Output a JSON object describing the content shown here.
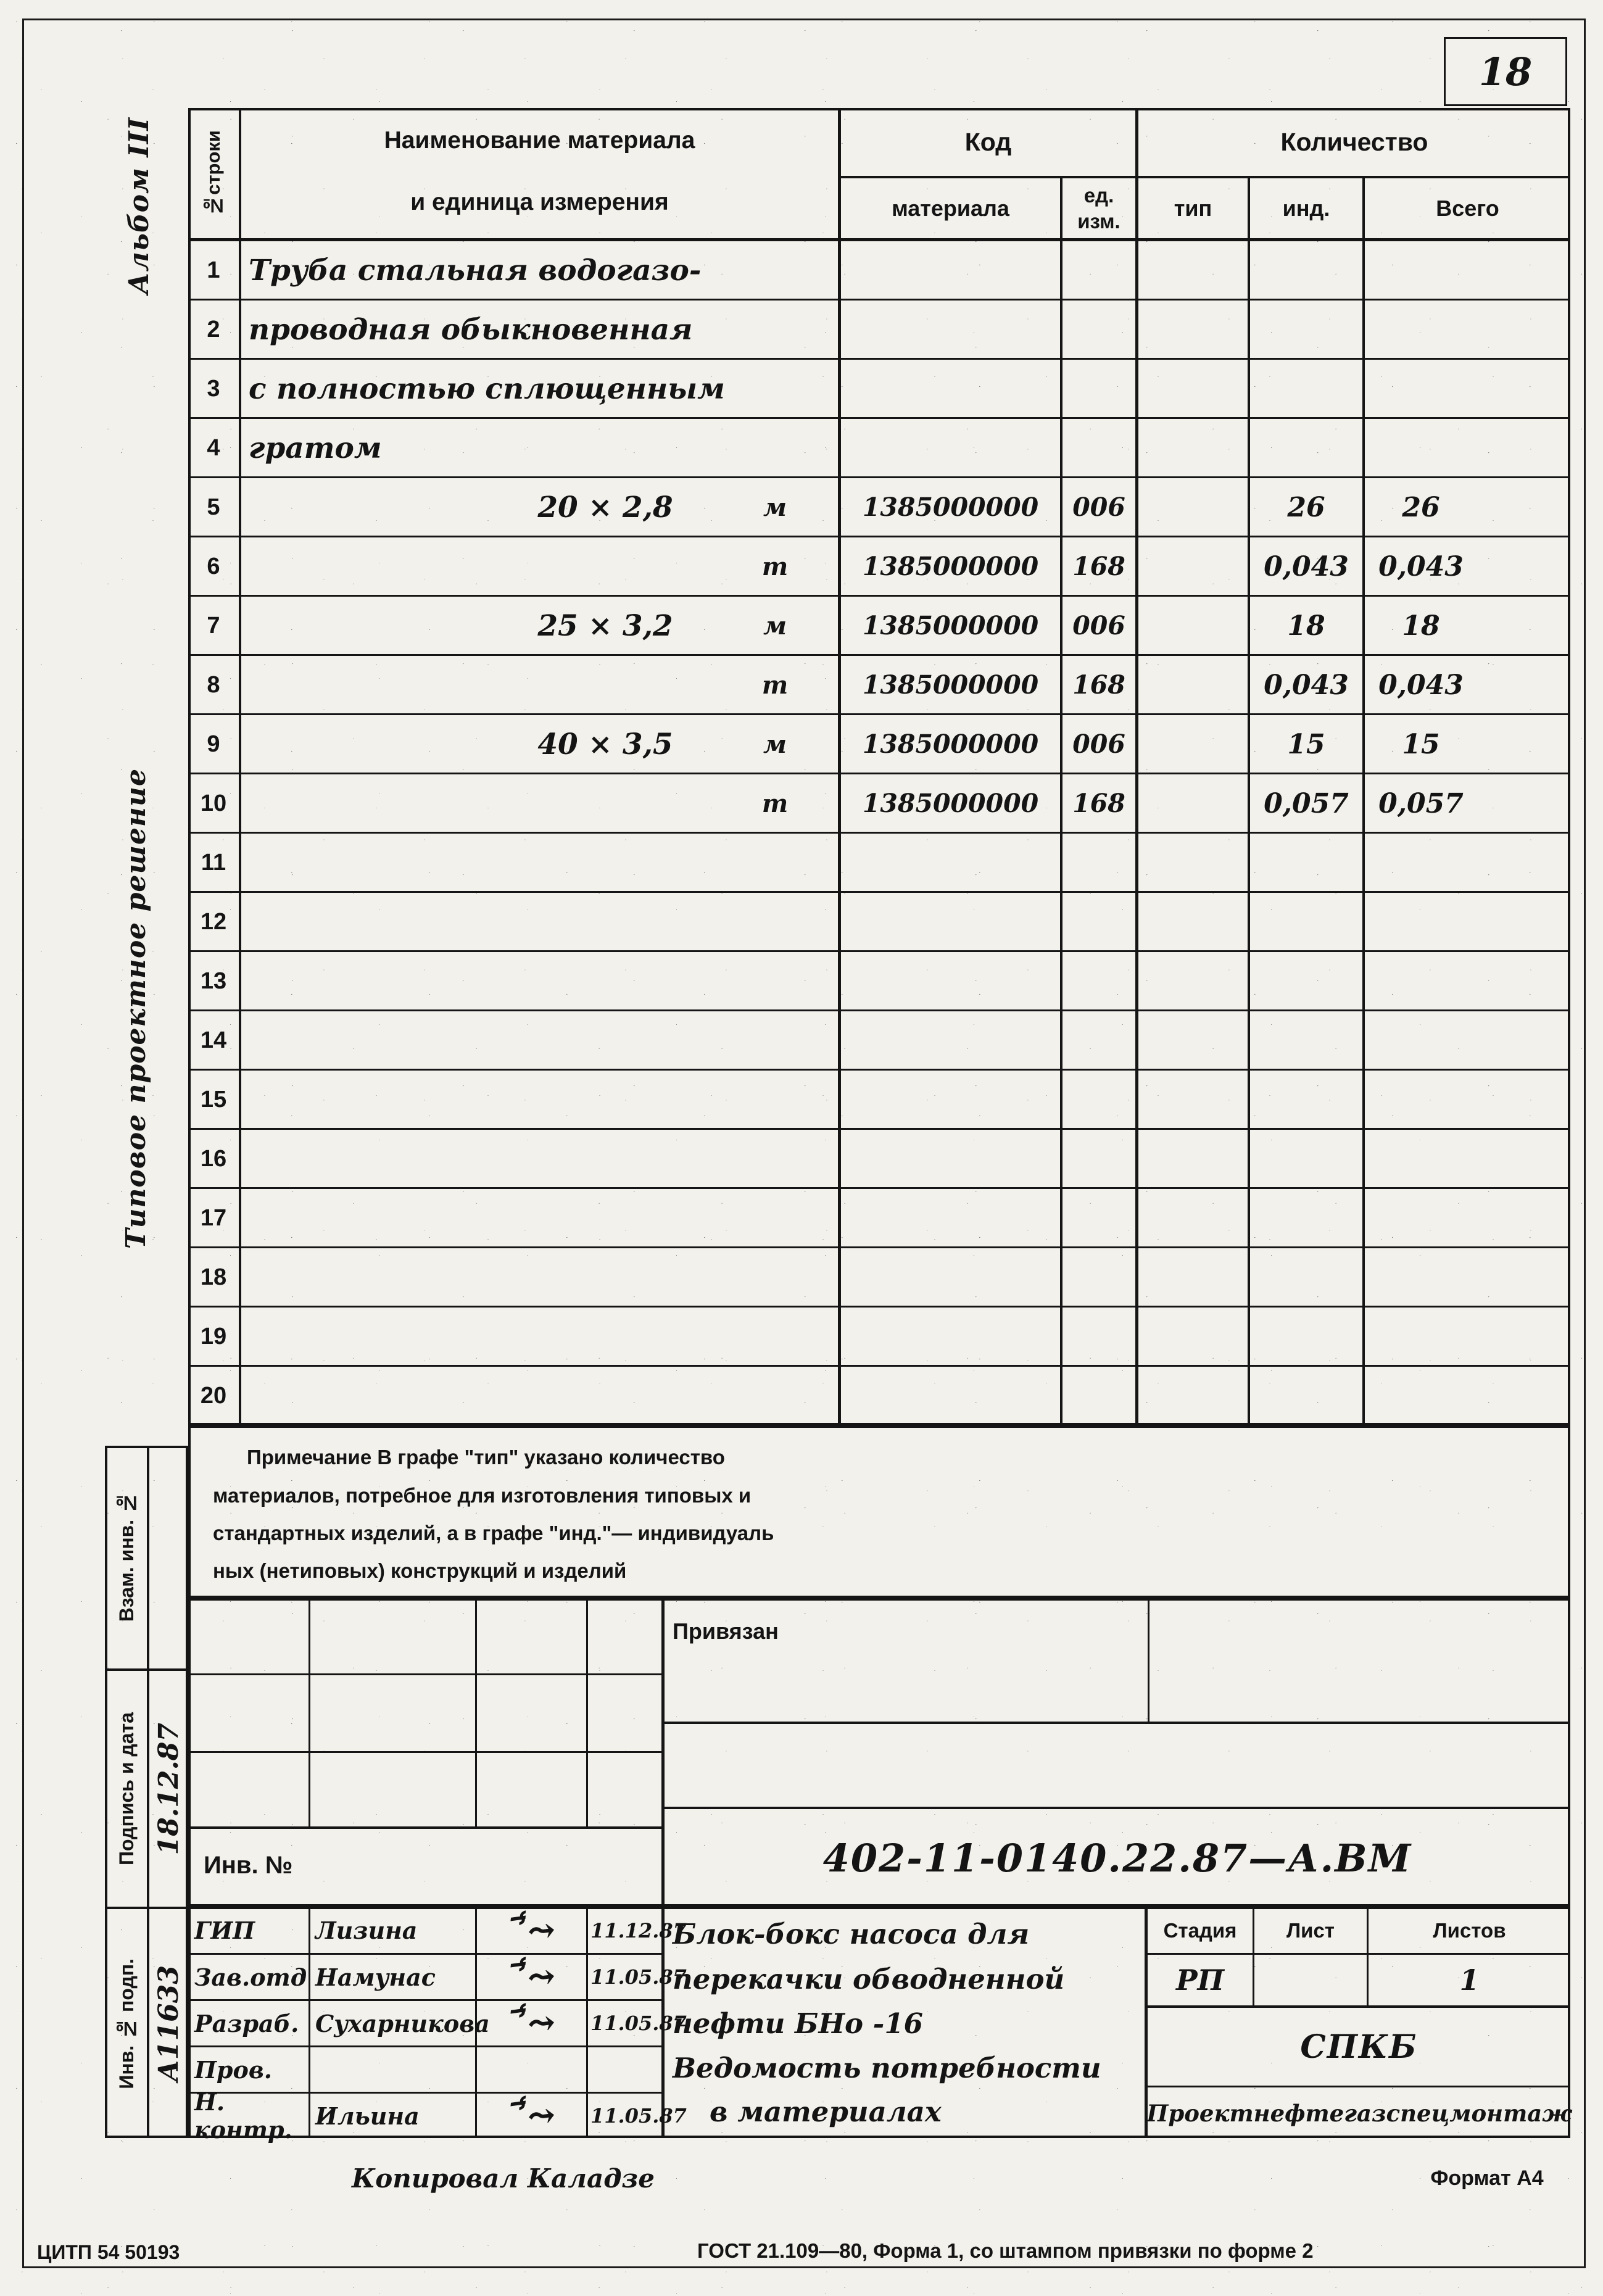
{
  "page": {
    "number": "18",
    "format_label": "Формат А4",
    "gost_footer": "ГОСТ 21.109—80, Форма 1, со штампом привязки по форме 2",
    "publisher_code": "ЦИТП    54 50193",
    "copied_by": "Копировал Каладзе"
  },
  "left_margin": {
    "album": "Альбом III",
    "typical_solution": "Типовое проектное решение",
    "stamp_labels": [
      "Взам. инв. №",
      "Подпись и дата",
      "Инв. № подп."
    ],
    "stamp_values": {
      "signature_date": "18.12.87",
      "inv_number": "А11633"
    }
  },
  "table": {
    "headers": {
      "row_no": "№строки",
      "material_name_line1": "Наименование материала",
      "material_name_line2": "и единица измерения",
      "code": "Код",
      "code_material": "материала",
      "code_unit_line1": "ед.",
      "code_unit_line2": "изм.",
      "quantity": "Количество",
      "qty_type": "тип",
      "qty_ind": "инд.",
      "qty_total": "Всего"
    },
    "rows": [
      {
        "no": "1",
        "name": "Труба стальная водогазо-",
        "code_material": "",
        "code_unit": "",
        "type": "",
        "ind": "",
        "total": ""
      },
      {
        "no": "2",
        "name": "проводная обыкновенная",
        "code_material": "",
        "code_unit": "",
        "type": "",
        "ind": "",
        "total": ""
      },
      {
        "no": "3",
        "name": "с полностью сплющенным",
        "code_material": "",
        "code_unit": "",
        "type": "",
        "ind": "",
        "total": ""
      },
      {
        "no": "4",
        "name": "гратом",
        "code_material": "",
        "code_unit": "",
        "type": "",
        "ind": "",
        "total": ""
      },
      {
        "no": "5",
        "name": "20 × 2,8",
        "unit": "м",
        "code_material": "1385000000",
        "code_unit": "006",
        "type": "",
        "ind": "26",
        "total": "26"
      },
      {
        "no": "6",
        "name": "",
        "unit": "т",
        "code_material": "1385000000",
        "code_unit": "168",
        "type": "",
        "ind": "0,043",
        "total": "0,043"
      },
      {
        "no": "7",
        "name": "25 × 3,2",
        "unit": "м",
        "code_material": "1385000000",
        "code_unit": "006",
        "type": "",
        "ind": "18",
        "total": "18"
      },
      {
        "no": "8",
        "name": "",
        "unit": "т",
        "code_material": "1385000000",
        "code_unit": "168",
        "type": "",
        "ind": "0,043",
        "total": "0,043"
      },
      {
        "no": "9",
        "name": "40 × 3,5",
        "unit": "м",
        "code_material": "1385000000",
        "code_unit": "006",
        "type": "",
        "ind": "15",
        "total": "15"
      },
      {
        "no": "10",
        "name": "",
        "unit": "т",
        "code_material": "1385000000",
        "code_unit": "168",
        "type": "",
        "ind": "0,057",
        "total": "0,057"
      },
      {
        "no": "11",
        "name": "",
        "unit": "",
        "code_material": "",
        "code_unit": "",
        "type": "",
        "ind": "",
        "total": ""
      },
      {
        "no": "12",
        "name": "",
        "unit": "",
        "code_material": "",
        "code_unit": "",
        "type": "",
        "ind": "",
        "total": ""
      },
      {
        "no": "13",
        "name": "",
        "unit": "",
        "code_material": "",
        "code_unit": "",
        "type": "",
        "ind": "",
        "total": ""
      },
      {
        "no": "14",
        "name": "",
        "unit": "",
        "code_material": "",
        "code_unit": "",
        "type": "",
        "ind": "",
        "total": ""
      },
      {
        "no": "15",
        "name": "",
        "unit": "",
        "code_material": "",
        "code_unit": "",
        "type": "",
        "ind": "",
        "total": ""
      },
      {
        "no": "16",
        "name": "",
        "unit": "",
        "code_material": "",
        "code_unit": "",
        "type": "",
        "ind": "",
        "total": ""
      },
      {
        "no": "17",
        "name": "",
        "unit": "",
        "code_material": "",
        "code_unit": "",
        "type": "",
        "ind": "",
        "total": ""
      },
      {
        "no": "18",
        "name": "",
        "unit": "",
        "code_material": "",
        "code_unit": "",
        "type": "",
        "ind": "",
        "total": ""
      },
      {
        "no": "19",
        "name": "",
        "unit": "",
        "code_material": "",
        "code_unit": "",
        "type": "",
        "ind": "",
        "total": ""
      },
      {
        "no": "20",
        "name": "",
        "unit": "",
        "code_material": "",
        "code_unit": "",
        "type": "",
        "ind": "",
        "total": ""
      }
    ]
  },
  "note": {
    "line1": "Примечание  В графе \"тип\" указано количество",
    "line2": "материалов, потребное для изготовления типовых и",
    "line3": "стандартных изделий, а в графе \"инд.\"— индивидуаль",
    "line4": "ных (нетиповых) конструкций и изделий"
  },
  "binding_stamp": {
    "attached_label": "Привязан",
    "inv_label": "Инв. №"
  },
  "title_block": {
    "doc_number": "402-11-0140.22.87—А.ВМ",
    "title_line1": "Блок-бокс насоса для",
    "title_line2": "перекачки обводненной",
    "title_line3": "нефти  БНо -16",
    "title_line4": "Ведомость потребности",
    "title_line5": "в материалах",
    "stage_label": "Стадия",
    "sheet_label": "Лист",
    "sheets_label": "Листов",
    "stage_value": "РП",
    "sheet_value": "",
    "sheets_value": "1",
    "org_short": "СПКБ",
    "org_full": "Проектнефтегазспецмонтаж",
    "roles": [
      {
        "role": "ГИП",
        "name": "Лизина",
        "date": "11.12.87"
      },
      {
        "role": "Зав.отд",
        "name": "Намунас",
        "date": "11.05.87"
      },
      {
        "role": "Разраб.",
        "name": "Сухарникова",
        "date": "11.05.87"
      },
      {
        "role": "Пров.",
        "name": "",
        "date": ""
      },
      {
        "role": "Н. контр.",
        "name": "Ильина",
        "date": "11.05.87"
      }
    ]
  }
}
